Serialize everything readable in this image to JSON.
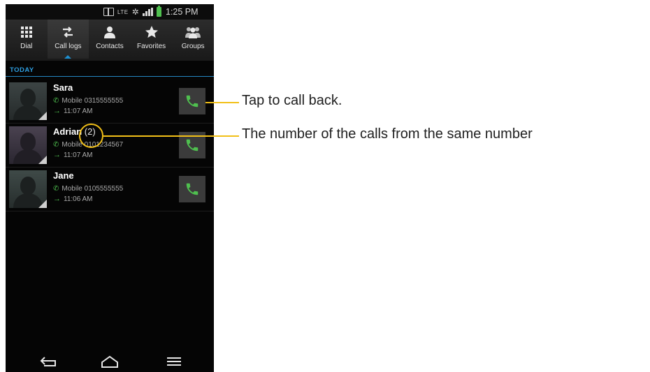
{
  "status_bar": {
    "network": "LTE",
    "time": "1:25 PM"
  },
  "tabs": [
    {
      "label": "Dial",
      "icon": "dialpad-icon"
    },
    {
      "label": "Call logs",
      "icon": "call-logs-icon",
      "active": true
    },
    {
      "label": "Contacts",
      "icon": "contacts-icon"
    },
    {
      "label": "Favorites",
      "icon": "favorites-star-icon"
    },
    {
      "label": "Groups",
      "icon": "groups-icon"
    }
  ],
  "section_header": "TODAY",
  "call_log": [
    {
      "name": "Sara",
      "count": "",
      "number": "Mobile 0315555555",
      "time": "11:07 AM"
    },
    {
      "name": "Adrian",
      "count": "(2)",
      "number": "Mobile 0101234567",
      "time": "11:07 AM"
    },
    {
      "name": "Jane",
      "count": "",
      "number": "Mobile 0105555555",
      "time": "11:06 AM"
    }
  ],
  "callouts": {
    "call_back": "Tap to call back.",
    "call_count": "The number of the calls from the same number"
  },
  "colors": {
    "accent_blue": "#2f9ee0",
    "call_green": "#4fc04f",
    "callout_yellow": "#f2c018"
  }
}
